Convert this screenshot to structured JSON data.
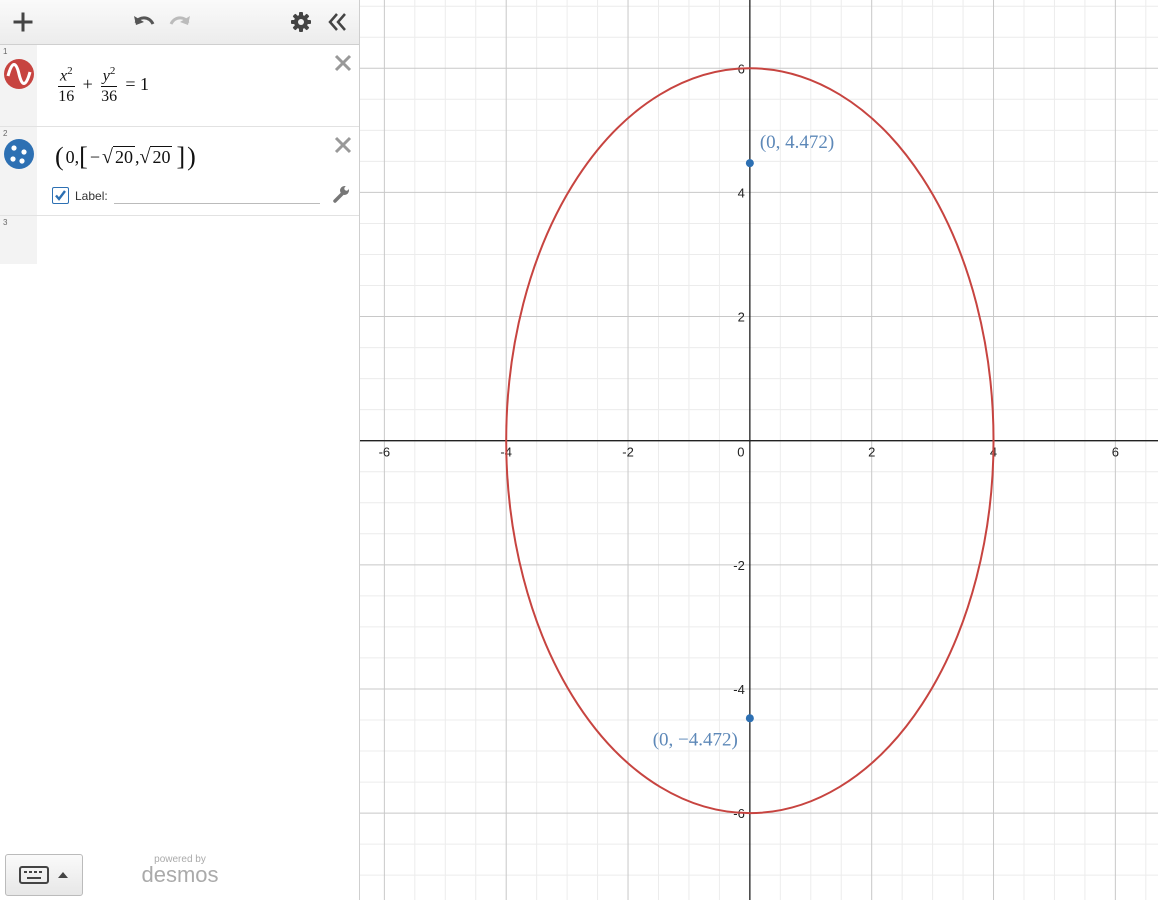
{
  "toolbar": {
    "add_icon": "plus-icon",
    "undo_icon": "undo-icon",
    "redo_icon": "redo-icon",
    "settings_icon": "gear-icon",
    "collapse_icon": "double-chevron-left-icon"
  },
  "expressions": [
    {
      "index": "1",
      "type": "equation",
      "latex": "x^2/16 + y^2/36 = 1",
      "parts": {
        "x": "x",
        "y": "y",
        "exp": "2",
        "den1": "16",
        "den2": "36",
        "plus": "+",
        "eq": "= 1"
      },
      "color": "#c74440",
      "icon": "curve-icon"
    },
    {
      "index": "2",
      "type": "points",
      "latex": "(0,[−√20,√20])",
      "parts": {
        "open": "(",
        "zero": "0,",
        "lbr": "[",
        "neg": "−",
        "rad1": "20",
        "comma": ",",
        "rad2": "20",
        "rbr": "]",
        "close": ")"
      },
      "color": "#2d70b3",
      "icon": "points-icon",
      "label_checkbox": {
        "checked": true,
        "text": "Label:"
      },
      "label_value": ""
    },
    {
      "index": "3",
      "type": "empty"
    }
  ],
  "footer": {
    "keyboard_icon": "keyboard-icon",
    "powered_by": "powered by",
    "brand": "desmos"
  },
  "graph": {
    "x_range": [
      -6.4,
      6.7
    ],
    "y_range": [
      -7.4,
      7.1
    ],
    "x_ticks": [
      "-6",
      "-4",
      "-2",
      "0",
      "2",
      "4",
      "6"
    ],
    "y_ticks": [
      "6",
      "4",
      "2",
      "-2",
      "-4",
      "-6"
    ],
    "ellipse": {
      "a": 4,
      "b": 6,
      "color": "#c74440"
    },
    "points": [
      {
        "x": 0,
        "y": 4.472,
        "label": "(0, 4.472)"
      },
      {
        "x": 0,
        "y": -4.472,
        "label": "(0, −4.472)"
      }
    ],
    "point_color": "#2d70b3",
    "label_color": "#5d88b8"
  }
}
